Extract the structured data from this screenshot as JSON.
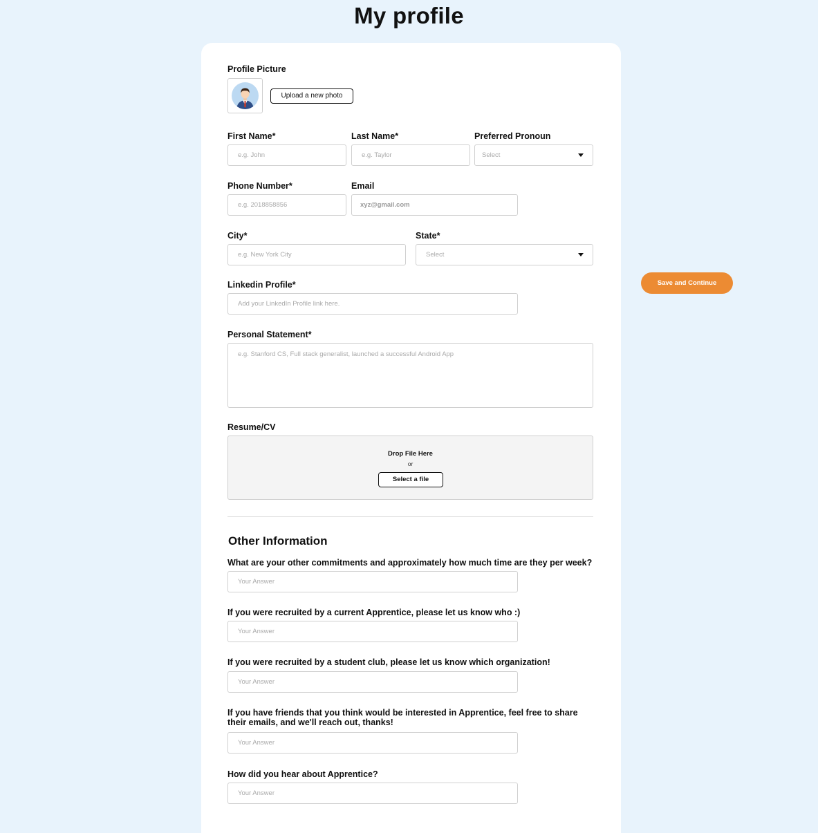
{
  "page": {
    "title": "My profile"
  },
  "profile_picture": {
    "label": "Profile Picture",
    "upload_label": "Upload a new photo",
    "avatar_icon": "person-avatar-icon"
  },
  "fields": {
    "first_name": {
      "label": "First Name*",
      "placeholder": "e.g. John"
    },
    "last_name": {
      "label": "Last Name*",
      "placeholder": "e.g. Taylor"
    },
    "pronoun": {
      "label": "Preferred Pronoun",
      "value": "Select"
    },
    "phone": {
      "label": "Phone Number*",
      "placeholder": "e.g. 2018858856"
    },
    "email": {
      "label": "Email",
      "value": "xyz@gmail.com"
    },
    "city": {
      "label": "City*",
      "placeholder": "e.g. New York City"
    },
    "state": {
      "label": "State*",
      "value": "Select"
    },
    "linkedin": {
      "label": "Linkedin Profile*",
      "placeholder": "Add your LinkedIn Profile link here."
    },
    "statement": {
      "label": "Personal Statement*",
      "placeholder": "e.g. Stanford CS, Full stack generalist, launched a successful Android App"
    }
  },
  "resume": {
    "label": "Resume/CV",
    "drop_text": "Drop File Here",
    "or_text": "or",
    "select_label": "Select a file"
  },
  "other": {
    "title": "Other Information",
    "questions": [
      {
        "label": "What are your other commitments and approximately how much time are they per week?",
        "placeholder": "Your Answer"
      },
      {
        "label": "If you were recruited by a current Apprentice, please let us know who :)",
        "placeholder": "Your Answer"
      },
      {
        "label": "If you were recruited by a student club, please let us know which organization!",
        "placeholder": "Your Answer"
      },
      {
        "label_line1": "If you have friends that you think would be interested in Apprentice, feel free to share",
        "label_line2": "their emails, and we'll reach out, thanks!",
        "placeholder": "Your Answer"
      },
      {
        "label": "How did you hear about Apprentice?",
        "placeholder": "Your Answer"
      }
    ]
  },
  "actions": {
    "save_label": "Save and Continue",
    "accent_color": "#ec8b33"
  }
}
